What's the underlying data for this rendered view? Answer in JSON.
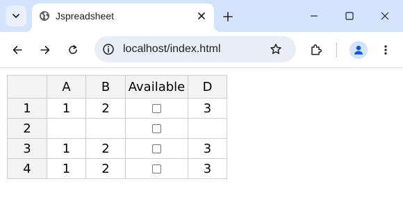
{
  "browser": {
    "tab": {
      "title": "Jspreadsheet",
      "favicon": "globe-icon"
    },
    "address_bar": {
      "url": "localhost/index.html"
    }
  },
  "sheet": {
    "corner": "",
    "columns": [
      "A",
      "B",
      "Available",
      "D"
    ],
    "rows": [
      {
        "label": "1",
        "cells": [
          "1",
          "2",
          "",
          "3"
        ],
        "available": false
      },
      {
        "label": "2",
        "cells": [
          "",
          "",
          "",
          ""
        ],
        "available": false
      },
      {
        "label": "3",
        "cells": [
          "1",
          "2",
          "",
          "3"
        ],
        "available": false
      },
      {
        "label": "4",
        "cells": [
          "1",
          "2",
          "",
          "3"
        ],
        "available": false
      }
    ]
  },
  "colors": {
    "tabstrip": "#d3e3fd",
    "omnibox": "#e9eef6",
    "header_bg": "#f3f3f3",
    "grid": "#cccccc"
  }
}
